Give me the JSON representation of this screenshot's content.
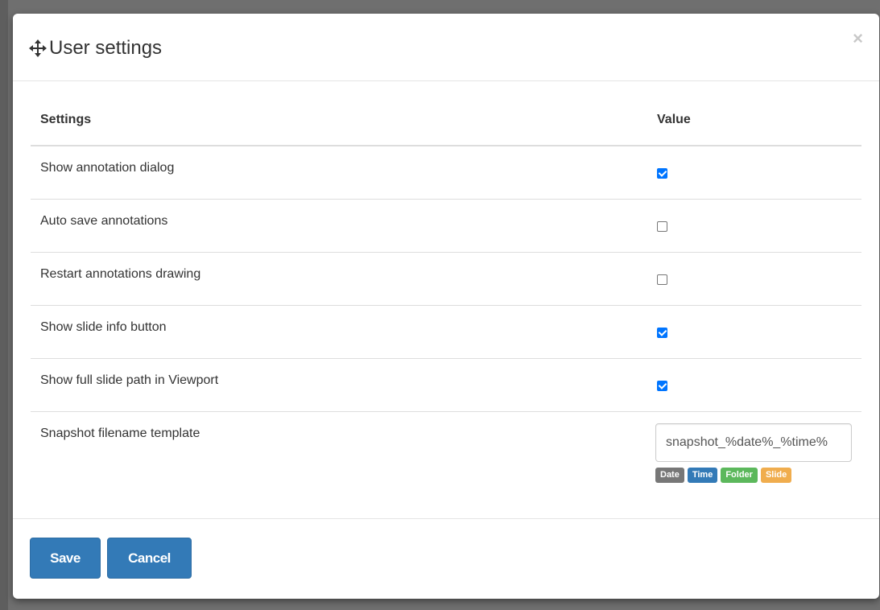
{
  "dialog": {
    "title": "User settings",
    "close_symbol": "×",
    "move_icon": "move-arrows-icon"
  },
  "table": {
    "headers": {
      "settings": "Settings",
      "value": "Value"
    },
    "rows": [
      {
        "label": "Show annotation dialog",
        "checked": true
      },
      {
        "label": "Auto save annotations",
        "checked": false
      },
      {
        "label": "Restart annotations drawing",
        "checked": false
      },
      {
        "label": "Show slide info button",
        "checked": true
      },
      {
        "label": "Show full slide path in Viewport",
        "checked": true
      }
    ],
    "snapshot": {
      "label": "Snapshot filename template",
      "value": "snapshot_%date%_%time%",
      "tags": [
        {
          "label": "Date",
          "color": "#777777"
        },
        {
          "label": "Time",
          "color": "#337ab7"
        },
        {
          "label": "Folder",
          "color": "#5cb85c"
        },
        {
          "label": "Slide",
          "color": "#f0ad4e"
        }
      ]
    }
  },
  "footer": {
    "save_label": "Save",
    "cancel_label": "Cancel"
  },
  "colors": {
    "primary": "#337ab7",
    "checkbox_accent": "#0075ff"
  }
}
